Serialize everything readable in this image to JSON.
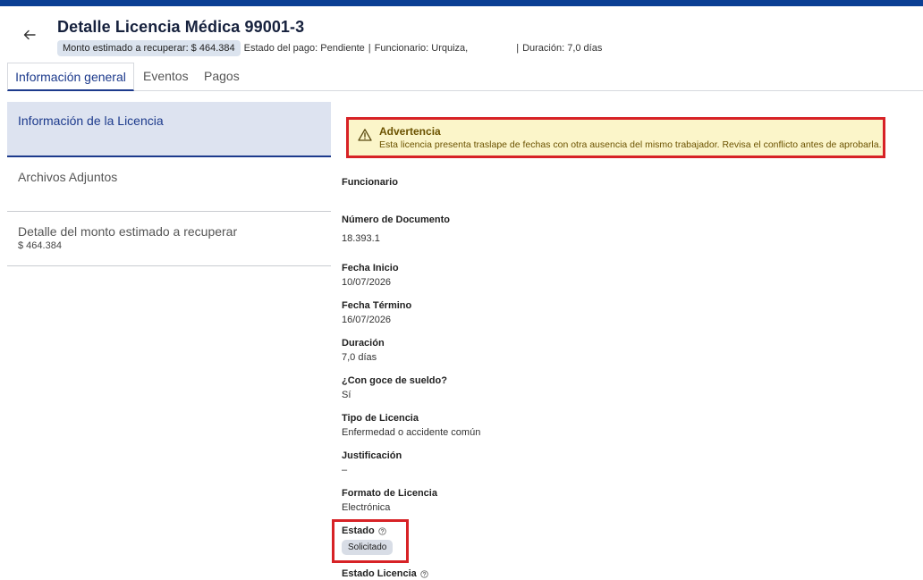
{
  "header": {
    "title": "Detalle Licencia Médica 99001-3",
    "amount_chip": "Monto estimado a recuperar: $ 464.384",
    "payment_status": "Estado del pago: Pendiente",
    "official": "Funcionario: Urquiza,",
    "duration": "Duración: 7,0 días",
    "separator": "|"
  },
  "tabs": [
    {
      "label": "Información general",
      "active": true
    },
    {
      "label": "Eventos",
      "active": false
    },
    {
      "label": "Pagos",
      "active": false
    }
  ],
  "sidenav": [
    {
      "label": "Información de la Licencia",
      "active": true
    },
    {
      "label": "Archivos Adjuntos",
      "active": false
    },
    {
      "label": "Detalle del monto estimado a recuperar",
      "sub": "$ 464.384",
      "active": false
    }
  ],
  "warning": {
    "title": "Advertencia",
    "text": "Esta licencia presenta traslape de fechas con otra ausencia del mismo trabajador. Revisa el conflicto antes de aprobarla."
  },
  "fields": {
    "funcionario": {
      "label": "Funcionario",
      "value": ""
    },
    "documento": {
      "label": "Número de Documento",
      "value": "18.393.1"
    },
    "fecha_inicio": {
      "label": "Fecha Inicio",
      "value": "10/07/2026"
    },
    "fecha_termino": {
      "label": "Fecha Término",
      "value": "16/07/2026"
    },
    "duracion": {
      "label": "Duración",
      "value": "7,0 días"
    },
    "goce": {
      "label": "¿Con goce de sueldo?",
      "value": "Sí"
    },
    "tipo": {
      "label": "Tipo de Licencia",
      "value": "Enfermedad o accidente común"
    },
    "justificacion": {
      "label": "Justificación",
      "value": "–"
    },
    "formato": {
      "label": "Formato de Licencia",
      "value": "Electrónica"
    },
    "estado": {
      "label": "Estado",
      "value": "Solicitado"
    },
    "estado_licencia": {
      "label": "Estado Licencia"
    }
  },
  "colors": {
    "topbar": "#0b3f94",
    "accent": "#1c3a8c",
    "highlight": "#d72226",
    "warning_bg": "#fbf5c9"
  },
  "icons": {
    "back": "arrow-left-icon",
    "warning": "warning-triangle-icon",
    "help": "help-circle-icon"
  }
}
